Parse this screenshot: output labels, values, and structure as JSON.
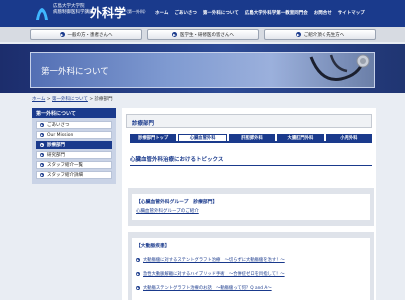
{
  "header": {
    "logo_line1": "広島大学大学院",
    "logo_line2": "病態制御医科学講座",
    "logo_title": "外科学",
    "logo_subtitle": "（第一外科）",
    "nav": [
      "ホーム",
      "ごあいさつ",
      "第一外科について",
      "広島大学外科学第一教室同門会",
      "お問合せ",
      "サイトマップ"
    ]
  },
  "audience": [
    {
      "label": "一般の方・患者さんへ"
    },
    {
      "label": "医学生・研修医の皆さんへ"
    },
    {
      "label": "ご紹介頂く先生方へ"
    }
  ],
  "banner": {
    "title": "第一外科について"
  },
  "breadcrumb": {
    "home": "ホーム",
    "section": "第一外科について",
    "sep": " > ",
    "current": "診療部門"
  },
  "sidebar": {
    "title": "第一外科について",
    "items": [
      {
        "label": "ごあいさつ",
        "active": false
      },
      {
        "label": "Our Mission",
        "active": false
      },
      {
        "label": "診療部門",
        "active": true
      },
      {
        "label": "研究部門",
        "active": false
      },
      {
        "label": "スタッフ紹介一覧",
        "active": false
      },
      {
        "label": "スタッフ紹介詳細",
        "active": false
      }
    ]
  },
  "main": {
    "section_title": "診療部門",
    "tabs": [
      {
        "label": "診療部門トップ",
        "active": false
      },
      {
        "label": "心臓血管外科",
        "active": true
      },
      {
        "label": "肝胆膵外科",
        "active": false
      },
      {
        "label": "大腸肛門外科",
        "active": false
      },
      {
        "label": "小児外科",
        "active": false
      }
    ],
    "topics_title": "心臓血管外科治療におけるトピックス",
    "group_box": {
      "title": "【心臓血管外科グループ　診療部門】",
      "link": "心臓血管外科グループのご紹介"
    },
    "aorta_box": {
      "title": "【大動脈疾患】",
      "links": [
        "大動脈瘤に対するステントグラフト治療　～切らずに大動脈瘤を治す！～",
        "急性大動脈解離に対するハイブリッド手術　～合併症ゼロを目指して！～",
        "大動脈ステントグラフト治療のお話　～動脈瘤って何？Q and A～"
      ]
    }
  },
  "colors": {
    "brand": "#1a3a8c",
    "background": "#e9edf3"
  }
}
